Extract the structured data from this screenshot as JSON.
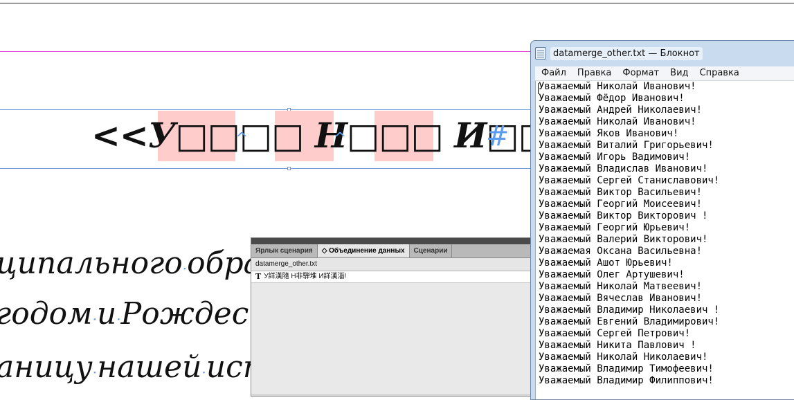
{
  "canvas": {
    "merge_field_text": "<<У□□□□ Н□□□ И□□□!>>",
    "hash_mark": "#",
    "body_lines": [
      [
        "ципального",
        "обра"
      ],
      [
        "годом",
        "и",
        "Рождест"
      ],
      [
        "аницу",
        "нашей",
        "ист"
      ]
    ],
    "colors": {
      "guide": "#e040e0",
      "frame": "#6f9bd8",
      "highlight": "#ffcccc",
      "hidden_char": "#5b9bf0"
    }
  },
  "panel": {
    "tabs": [
      {
        "label": "Ярлык сценария",
        "active": false
      },
      {
        "label": "◇ Объединение данных",
        "active": true
      },
      {
        "label": "Сценарии",
        "active": false
      }
    ],
    "file_name": "datamerge_other.txt",
    "field_icon": "T",
    "field_name": "У詳漢隨 Н非騨堆 И詳漢淄!"
  },
  "notepad": {
    "title": "datamerge_other.txt — Блокнот",
    "app_icon": "notepad-icon",
    "menu": [
      "Файл",
      "Правка",
      "Формат",
      "Вид",
      "Справка"
    ],
    "lines": [
      "Уважаемый Николай Иванович!",
      "Уважаемый Фёдор Иванович!",
      "Уважаемый Андрей Николаевич!",
      "Уважаемый Николай Иванович!",
      "Уважаемый Яков Иванович!",
      "Уважаемый Виталий Григорьевич!",
      "Уважаемый Игорь Вадимович!",
      "Уважаемый Владислав Иванович!",
      "Уважаемый Сергей Станиславович!",
      "Уважаемый Виктор Васильевич!",
      "Уважаемый Георгий Моисеевич!",
      "Уважаемый Виктор Викторович !",
      "Уважаемый Георгий Юрьевич!",
      "Уважаемый Валерий Викторович!",
      "Уважаемая Оксана Васильевна!",
      "Уважаемый Ашот Юрьевич!",
      "Уважаемый Олег Артушевич!",
      "Уважаемый Николай Матвеевич!",
      "Уважаемый Вячеслав Иванович!",
      "Уважаемый Владимир Николаевич !",
      "Уважаемый Евгений Владимирович!",
      "Уважаемый Сергей Петрович!",
      "Уважаемый Никита Павлович !",
      "Уважаемый Николай Николаевич!",
      "Уважаемый Владимир Тимофеевич!",
      "Уважаемый Владимир Филиппович!"
    ]
  }
}
